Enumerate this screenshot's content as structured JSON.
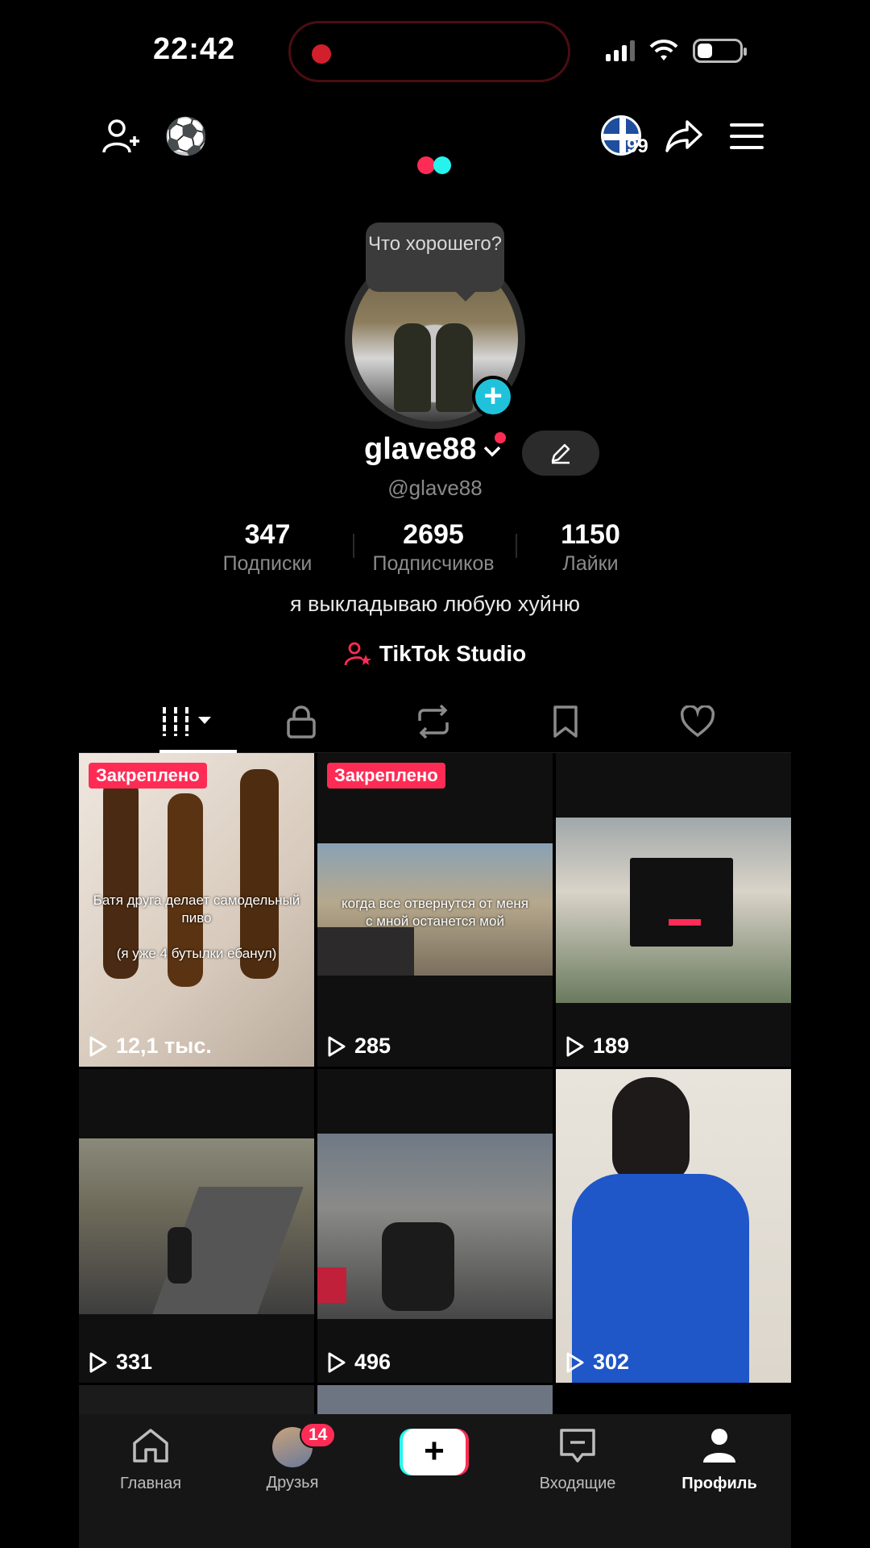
{
  "status_bar": {
    "time": "22:42"
  },
  "top_nav": {
    "badge_count": "99"
  },
  "profile": {
    "tooltip": "Что хорошего?",
    "username": "glave88",
    "handle": "@glave88",
    "stats": [
      {
        "value": "347",
        "label": "Подписки"
      },
      {
        "value": "2695",
        "label": "Подписчиков"
      },
      {
        "value": "1150",
        "label": "Лайки"
      }
    ],
    "bio": "я выкладываю любую хуйню",
    "studio_label": "TikTok Studio"
  },
  "videos": [
    {
      "pinned": "Закреплено",
      "views": "12,1 тыс.",
      "caption": "Батя друга делает самодельный пиво\n\n(я уже 4 бутылки ебанул)"
    },
    {
      "pinned": "Закреплено",
      "views": "285",
      "caption": "когда все отвернутся от меня с мной останется мой"
    },
    {
      "views": "189"
    },
    {
      "views": "331"
    },
    {
      "views": "496"
    },
    {
      "views": "302"
    }
  ],
  "bottom_nav": {
    "home": "Главная",
    "friends": "Друзья",
    "friends_badge": "14",
    "inbox": "Входящие",
    "profile": "Профиль"
  },
  "colors": {
    "accent": "#fe2c55",
    "cyan": "#25f4ee",
    "plus": "#20c2db"
  },
  "icons": [
    "add-friend-icon",
    "soccer-ball-icon",
    "share-icon",
    "menu-icon",
    "edit-icon",
    "grid-icon",
    "lock-icon",
    "repost-icon",
    "bookmark-icon",
    "heart-icon",
    "play-icon",
    "home-icon",
    "inbox-icon",
    "profile-icon"
  ]
}
